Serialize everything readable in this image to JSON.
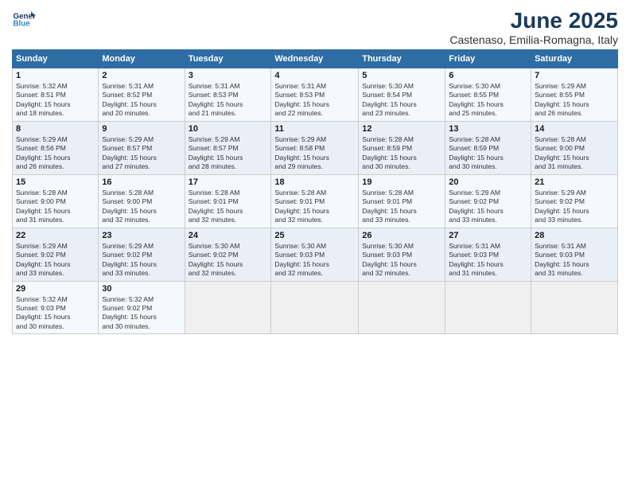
{
  "logo": {
    "line1": "General",
    "line2": "Blue"
  },
  "title": "June 2025",
  "subtitle": "Castenaso, Emilia-Romagna, Italy",
  "headers": [
    "Sunday",
    "Monday",
    "Tuesday",
    "Wednesday",
    "Thursday",
    "Friday",
    "Saturday"
  ],
  "weeks": [
    [
      {
        "day": "1",
        "info": "Sunrise: 5:32 AM\nSunset: 8:51 PM\nDaylight: 15 hours\nand 18 minutes."
      },
      {
        "day": "2",
        "info": "Sunrise: 5:31 AM\nSunset: 8:52 PM\nDaylight: 15 hours\nand 20 minutes."
      },
      {
        "day": "3",
        "info": "Sunrise: 5:31 AM\nSunset: 8:53 PM\nDaylight: 15 hours\nand 21 minutes."
      },
      {
        "day": "4",
        "info": "Sunrise: 5:31 AM\nSunset: 8:53 PM\nDaylight: 15 hours\nand 22 minutes."
      },
      {
        "day": "5",
        "info": "Sunrise: 5:30 AM\nSunset: 8:54 PM\nDaylight: 15 hours\nand 23 minutes."
      },
      {
        "day": "6",
        "info": "Sunrise: 5:30 AM\nSunset: 8:55 PM\nDaylight: 15 hours\nand 25 minutes."
      },
      {
        "day": "7",
        "info": "Sunrise: 5:29 AM\nSunset: 8:55 PM\nDaylight: 15 hours\nand 26 minutes."
      }
    ],
    [
      {
        "day": "8",
        "info": "Sunrise: 5:29 AM\nSunset: 8:56 PM\nDaylight: 15 hours\nand 26 minutes."
      },
      {
        "day": "9",
        "info": "Sunrise: 5:29 AM\nSunset: 8:57 PM\nDaylight: 15 hours\nand 27 minutes."
      },
      {
        "day": "10",
        "info": "Sunrise: 5:29 AM\nSunset: 8:57 PM\nDaylight: 15 hours\nand 28 minutes."
      },
      {
        "day": "11",
        "info": "Sunrise: 5:29 AM\nSunset: 8:58 PM\nDaylight: 15 hours\nand 29 minutes."
      },
      {
        "day": "12",
        "info": "Sunrise: 5:28 AM\nSunset: 8:59 PM\nDaylight: 15 hours\nand 30 minutes."
      },
      {
        "day": "13",
        "info": "Sunrise: 5:28 AM\nSunset: 8:59 PM\nDaylight: 15 hours\nand 30 minutes."
      },
      {
        "day": "14",
        "info": "Sunrise: 5:28 AM\nSunset: 9:00 PM\nDaylight: 15 hours\nand 31 minutes."
      }
    ],
    [
      {
        "day": "15",
        "info": "Sunrise: 5:28 AM\nSunset: 9:00 PM\nDaylight: 15 hours\nand 31 minutes."
      },
      {
        "day": "16",
        "info": "Sunrise: 5:28 AM\nSunset: 9:00 PM\nDaylight: 15 hours\nand 32 minutes."
      },
      {
        "day": "17",
        "info": "Sunrise: 5:28 AM\nSunset: 9:01 PM\nDaylight: 15 hours\nand 32 minutes."
      },
      {
        "day": "18",
        "info": "Sunrise: 5:28 AM\nSunset: 9:01 PM\nDaylight: 15 hours\nand 32 minutes."
      },
      {
        "day": "19",
        "info": "Sunrise: 5:28 AM\nSunset: 9:01 PM\nDaylight: 15 hours\nand 33 minutes."
      },
      {
        "day": "20",
        "info": "Sunrise: 5:29 AM\nSunset: 9:02 PM\nDaylight: 15 hours\nand 33 minutes."
      },
      {
        "day": "21",
        "info": "Sunrise: 5:29 AM\nSunset: 9:02 PM\nDaylight: 15 hours\nand 33 minutes."
      }
    ],
    [
      {
        "day": "22",
        "info": "Sunrise: 5:29 AM\nSunset: 9:02 PM\nDaylight: 15 hours\nand 33 minutes."
      },
      {
        "day": "23",
        "info": "Sunrise: 5:29 AM\nSunset: 9:02 PM\nDaylight: 15 hours\nand 33 minutes."
      },
      {
        "day": "24",
        "info": "Sunrise: 5:30 AM\nSunset: 9:02 PM\nDaylight: 15 hours\nand 32 minutes."
      },
      {
        "day": "25",
        "info": "Sunrise: 5:30 AM\nSunset: 9:03 PM\nDaylight: 15 hours\nand 32 minutes."
      },
      {
        "day": "26",
        "info": "Sunrise: 5:30 AM\nSunset: 9:03 PM\nDaylight: 15 hours\nand 32 minutes."
      },
      {
        "day": "27",
        "info": "Sunrise: 5:31 AM\nSunset: 9:03 PM\nDaylight: 15 hours\nand 31 minutes."
      },
      {
        "day": "28",
        "info": "Sunrise: 5:31 AM\nSunset: 9:03 PM\nDaylight: 15 hours\nand 31 minutes."
      }
    ],
    [
      {
        "day": "29",
        "info": "Sunrise: 5:32 AM\nSunset: 9:03 PM\nDaylight: 15 hours\nand 30 minutes."
      },
      {
        "day": "30",
        "info": "Sunrise: 5:32 AM\nSunset: 9:02 PM\nDaylight: 15 hours\nand 30 minutes."
      },
      {
        "day": "",
        "info": ""
      },
      {
        "day": "",
        "info": ""
      },
      {
        "day": "",
        "info": ""
      },
      {
        "day": "",
        "info": ""
      },
      {
        "day": "",
        "info": ""
      }
    ]
  ]
}
